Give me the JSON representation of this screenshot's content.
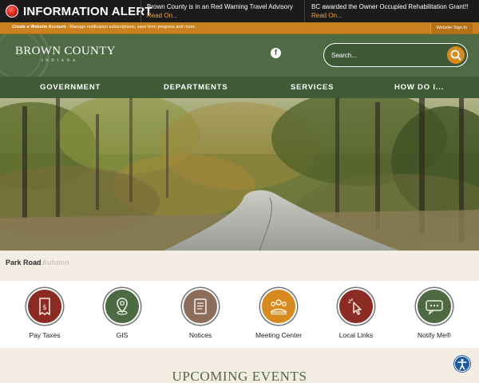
{
  "alert": {
    "title": "INFORMATION ALERT",
    "items": [
      {
        "text": "Brown County is in an Red Warning Travel Advisory",
        "link": "Read On..."
      },
      {
        "text": "BC awarded the Owner Occupied Rehabilitation Grant!!",
        "link": "Read On..."
      }
    ]
  },
  "account_bar": {
    "create_label": "Create a Website Account",
    "description": " - Manage notification subscriptions, save form progress and more.",
    "signin_label": "Website Sign In"
  },
  "header": {
    "logo_title": "BROWN COUNTY",
    "logo_subtitle": "INDIANA",
    "facebook_icon": "facebook-icon",
    "search_placeholder": "Search..."
  },
  "nav": {
    "items": [
      {
        "label": "GOVERNMENT"
      },
      {
        "label": "DEPARTMENTS"
      },
      {
        "label": "SERVICES"
      },
      {
        "label": "HOW DO I..."
      }
    ]
  },
  "hero": {
    "caption": "Park Road",
    "caption_ghost": "s in Autumn"
  },
  "quick_links": [
    {
      "label": "Pay Taxes",
      "icon": "receipt-dollar-icon",
      "color": "#8b2b24"
    },
    {
      "label": "GIS",
      "icon": "map-pin-icon",
      "color": "#4e6a43"
    },
    {
      "label": "Notices",
      "icon": "document-icon",
      "color": "#8c6c5a"
    },
    {
      "label": "Meeting Center",
      "icon": "meeting-icon",
      "color": "#d98a1f"
    },
    {
      "label": "Local Links",
      "icon": "cursor-click-icon",
      "color": "#8b2b24"
    },
    {
      "label": "Notify Me®",
      "icon": "chat-icon",
      "color": "#4e6a43"
    }
  ],
  "events": {
    "title": "UPCOMING EVENTS"
  },
  "colors": {
    "alert_link": "#f0a04a",
    "account_bar": "#c8811e",
    "header_green": "#4f6b46",
    "nav_green": "#3e5b35",
    "accent_orange": "#d88a1e"
  }
}
